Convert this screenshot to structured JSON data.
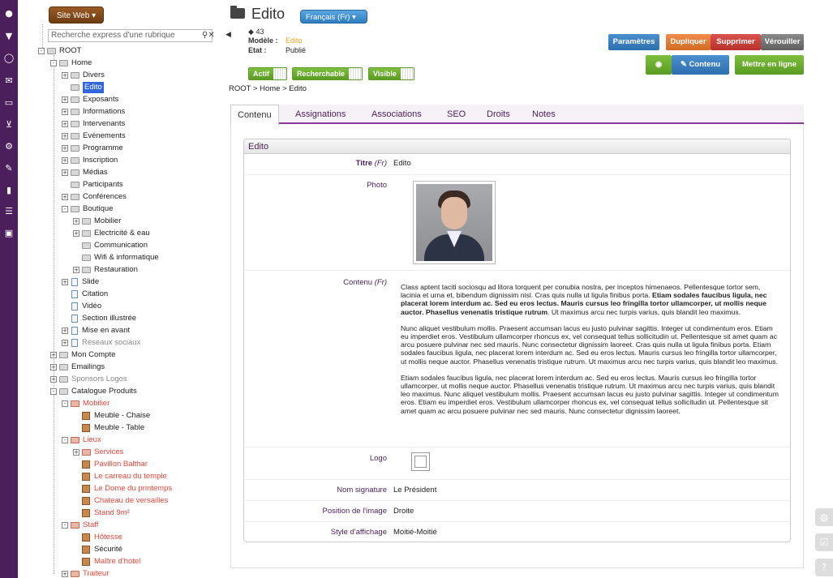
{
  "rail_icons": [
    "user-icon",
    "filter-icon",
    "lightbulb-icon",
    "mail-icon",
    "monitor-icon",
    "cart-icon",
    "gears-icon",
    "wrench-icon",
    "file-icon",
    "list-icon",
    "lock-icon"
  ],
  "tree": {
    "site_button": "Site Web",
    "search_placeholder": "Recherche express d'une rubrique",
    "nodes": [
      "ROOT",
      "Home",
      "Divers",
      "Edito",
      "Exposants",
      "Informations",
      "Intervenants",
      "Evénements",
      "Programme",
      "Inscription",
      "Médias",
      "Participants",
      "Conférences",
      "Boutique",
      "Mobilier",
      "Electricité & eau",
      "Communication",
      "Wifi & informatique",
      "Restauration",
      "Slide",
      "Citation",
      "Vidéo",
      "Section illustrée",
      "Mise en avant",
      "Réseaux sociaux",
      "Mon Compte",
      "Emailings",
      "Sponsors Logos",
      "Catalogue Produits",
      "Mobilier",
      "Meuble - Chaise",
      "Meuble - Table",
      "Lieux",
      "Services",
      "Pavillon Balthar",
      "Le carreau du temple",
      "Le Dome du printemps",
      "Chateau de versailles",
      "Stand 9m²",
      "Staff",
      "Hôtesse",
      "Sécurité",
      "Maître d'hotel",
      "Traiteur"
    ]
  },
  "header": {
    "title": "Edito",
    "language": "Français (Fr)",
    "tag_count": "43",
    "modele_label": "Modèle :",
    "modele_value": "Edito",
    "etat_label": "Etat :",
    "etat_value": "Publié",
    "toggles": [
      "Actif",
      "Recherchable",
      "Visible"
    ],
    "breadcrumb": "ROOT > Home > Edito"
  },
  "actions": {
    "params": "Paramètres",
    "duplicate": "Dupliquer",
    "delete": "Supprimer",
    "lock": "Vérouiller",
    "content": "Contenu",
    "online": "Mettre en ligne"
  },
  "tabs": [
    "Contenu",
    "Assignations",
    "Associations",
    "SEO",
    "Droits",
    "Notes"
  ],
  "panel": {
    "heading": "Edito",
    "titre_label": "Titre",
    "fr": "(Fr)",
    "titre_value": "Edito",
    "photo_label": "Photo",
    "contenu_label": "Contenu",
    "content_p1_a": "Class aptent taciti sociosqu ad litora torquent per conubia nostra, per inceptos himenaeos. Pellentesque tortor sem, lacinia et urna et, bibendum dignissim nisl. Cras quis nulla ut ligula finibus porta.",
    "content_p1_b": "Etiam sodales faucibus ligula, nec placerat lorem interdum ac. Sed eu eros lectus. Mauris cursus leo fringilla tortor ullamcorper, ut mollis neque auctor. Phasellus venenatis tristique rutrum",
    "content_p1_c": ". Ut maximus arcu nec turpis varius, quis blandit leo maximus.",
    "content_p2": "Nunc aliquet vestibulum mollis. Praesent accumsan lacus eu justo pulvinar sagittis. Integer ut condimentum eros. Etiam eu imperdiet eros. Vestibulum ullamcorper rhoncus ex, vel consequat tellus sollicitudin ut. Pellentesque sit amet quam ac arcu posuere pulvinar nec sed mauris. Nunc consectetur dignissim laoreet. Cras quis nulla ut ligula finibus porta. Etiam sodales faucibus ligula, nec placerat lorem interdum ac. Sed eu eros lectus. Mauris cursus leo fringilla tortor ullamcorper, ut mollis neque auctor. Phasellus venenatis tristique rutrum. Ut maximus arcu nec turpis varius, quis blandit leo maximus.",
    "content_p3": "Etiam sodales faucibus ligula, nec placerat lorem interdum ac. Sed eu eros lectus. Mauris cursus leo fringilla tortor ullamcorper, ut mollis neque auctor. Phasellus venenatis tristique rutrum. Ut maximus arcu nec turpis varius, quis blandit leo maximus. Nunc aliquet vestibulum mollis. Praesent accumsan lacus eu justo pulvinar sagittis. Integer ut condimentum eros. Etiam eu imperdiet eros. Vestibulum ullamcorper rhoncus ex, vel consequat tellus sollicitudin ut. Pellentesque sit amet quam ac arcu posuere pulvinar nec sed mauris. Nunc consectetur dignissim laoreet.",
    "logo_label": "Logo",
    "signature_label": "Nom signature",
    "signature_value": "Le Président",
    "position_label": "Position de l'image",
    "position_value": "Droite",
    "style_label": "Style d'affichage",
    "style_value": "Moitié-Moitié"
  },
  "colors": {
    "rail": "#4b1f5b",
    "accent": "#8b3a9b",
    "red_node": "#e2483a"
  }
}
